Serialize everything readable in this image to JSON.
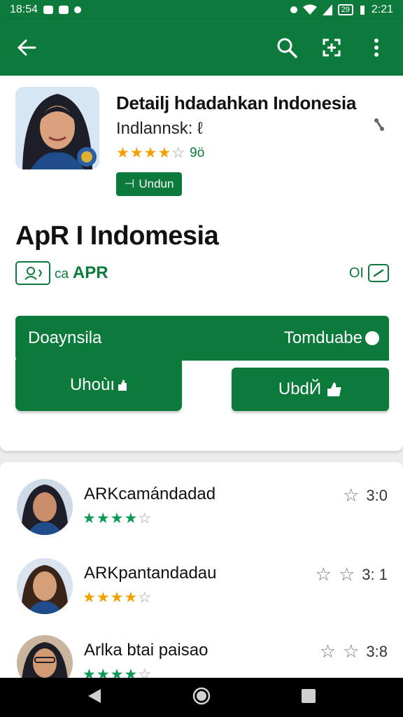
{
  "status_bar": {
    "time": "18:54",
    "clock": "2:21",
    "battery": "29"
  },
  "toolbar": {
    "back_icon": "arrow-left-icon",
    "search_icon": "search-icon",
    "scan_icon": "scan-icon",
    "more_icon": "more-vert-icon"
  },
  "app": {
    "title": "Detailj hdadahkan Indonesia",
    "subtitle": "Indlannsk: ℓ",
    "rating_count": "9ö",
    "download_label": "Undun",
    "download_prefix": "⊣",
    "big_title": "ApR I Indomesia",
    "tag_prefix": "ca",
    "tag_name": "APR",
    "tag_right_number": "ОІ",
    "stars_filled": 4,
    "stars_total": 5
  },
  "actions": {
    "panel_left": "Doaynsila",
    "panel_right": "Tomduabe",
    "button_left": "Uhoùı",
    "button_right": "UbdЙ"
  },
  "reviews": [
    {
      "name": "ARKcamándadad",
      "score": "3:0",
      "stars": 4,
      "star_color": "green",
      "score_stars": 1
    },
    {
      "name": "ARKpantandadau",
      "score": "3: 1",
      "stars": 4,
      "star_color": "gold",
      "score_stars": 2
    },
    {
      "name": "Arlka btai paisao",
      "score": "3:8",
      "stars": 4,
      "star_color": "green",
      "score_stars": 2
    }
  ],
  "colors": {
    "brand_green": "#0b7a3b",
    "star_gold": "#f3a100",
    "star_green": "#0b9a55"
  }
}
